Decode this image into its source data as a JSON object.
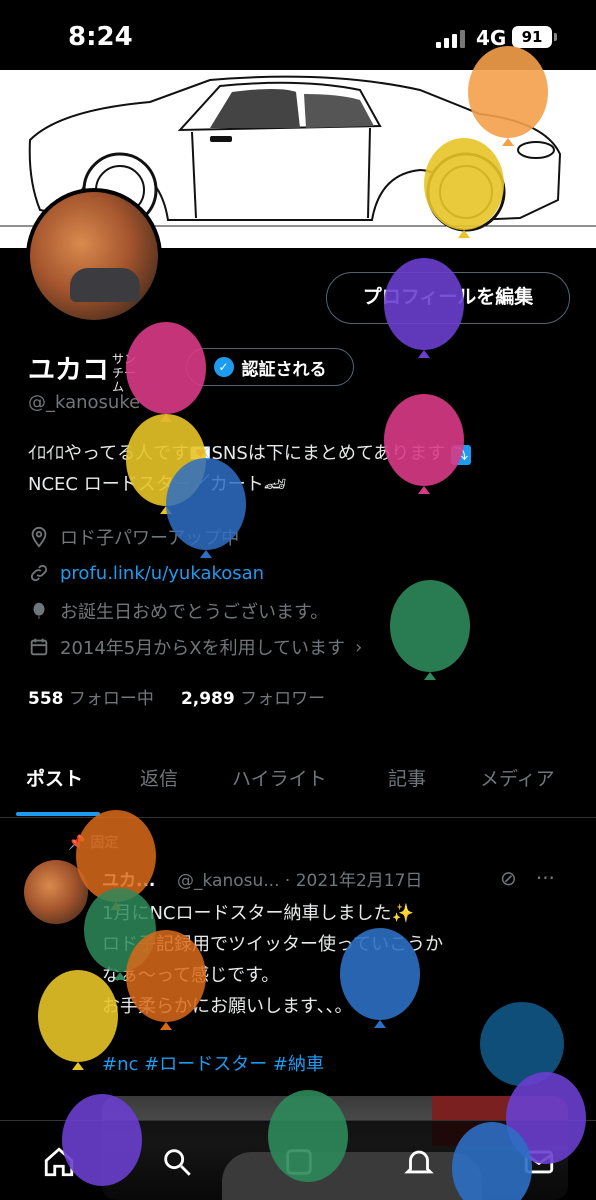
{
  "status_bar": {
    "time": "8:24",
    "network": "4G",
    "battery": "91"
  },
  "profile": {
    "edit_button": "プロフィールを編集",
    "name": "ユカコ",
    "name_suffix": "サンチーム",
    "verify_button": "認証される",
    "handle": "@_kanosuke",
    "bio_line1": "ｲﾛｲﾛやってる人です💌SNSは下にまとめてあります",
    "bio_arrow": "⤵",
    "bio_line2": "NCEC ロードスター／カート🏎",
    "location": "ロド子パワーアップ中",
    "website": "profu.link/u/yukakosan",
    "birthday": "お誕生日おめでとうございます。",
    "joined": "2014年5月からXを利用しています",
    "following_count": "558",
    "following_label": "フォロー中",
    "followers_count": "2,989",
    "followers_label": "フォロワー"
  },
  "tabs": [
    {
      "label": "ポスト",
      "active": true
    },
    {
      "label": "返信"
    },
    {
      "label": "ハイライト"
    },
    {
      "label": "記事"
    },
    {
      "label": "メディア"
    }
  ],
  "pinned_post": {
    "pinned_label": "固定",
    "author_name": "ユカ...",
    "handle": "@_kanosu...",
    "date": "· 2021年2月17日",
    "text_line1": "1月にNCロードスター納車しました✨",
    "text_line2": "ロド子記録用でツイッター使っていこうか",
    "text_line3": "なぁ〜って感じです。",
    "text_line4": "お手柔らかにお願いします、、。",
    "hashtags": "#nc #ロードスター #納車"
  },
  "icons": {
    "location": "location-pin-icon",
    "link": "link-icon",
    "birthday": "balloon-icon",
    "joined": "calendar-icon"
  },
  "colors": {
    "accent": "#1d9bf0",
    "background": "#000000",
    "muted": "#71767b"
  }
}
